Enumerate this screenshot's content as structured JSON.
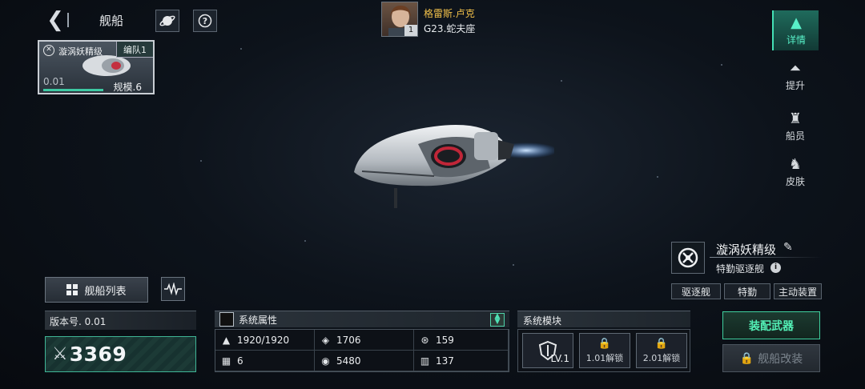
{
  "header": {
    "title": "舰船",
    "back_icon": "chevron-left-icon",
    "planet_icon": "planet-icon",
    "help_icon": "question-icon"
  },
  "ship_card": {
    "name": "漩涡妖精级",
    "fleet_tag": "编队1",
    "version": "0.01",
    "scale": "规模.6",
    "progress": 0.55
  },
  "commander": {
    "name": "格雷斯.卢克",
    "level": "1",
    "location": "G23.蛇夫座"
  },
  "tabs": [
    {
      "label": "详情",
      "icon": "ship-detail-icon",
      "active": true
    },
    {
      "label": "提升",
      "icon": "upgrade-icon"
    },
    {
      "label": "船员",
      "icon": "crew-icon"
    },
    {
      "label": "皮肤",
      "icon": "skin-icon"
    }
  ],
  "ship_info": {
    "name": "漩涡妖精级",
    "type": "特勤驱逐舰",
    "chips": [
      "驱逐舰",
      "特勤",
      "主动装置"
    ]
  },
  "ship_list": {
    "label": "舰船列表"
  },
  "power": {
    "version_label": "版本号. 0.01",
    "value": "3369"
  },
  "stats": {
    "title": "系统属性",
    "cells": [
      {
        "icon": "hull-icon",
        "value": "1920/1920"
      },
      {
        "icon": "armor-icon",
        "value": "1706"
      },
      {
        "icon": "shield-icon",
        "value": "159"
      },
      {
        "icon": "checker-icon",
        "value": "6"
      },
      {
        "icon": "target-icon",
        "value": "5480"
      },
      {
        "icon": "speed-icon",
        "value": "137"
      }
    ]
  },
  "modules": {
    "title": "系统模块",
    "items": [
      {
        "label": "LV.1"
      },
      {
        "label": "1.01解锁"
      },
      {
        "label": "2.01解锁"
      }
    ]
  },
  "actions": {
    "equip": "装配武器",
    "refit": "舰船改装"
  },
  "colors": {
    "accent": "#44e0b5",
    "gold": "#f2c14a"
  }
}
